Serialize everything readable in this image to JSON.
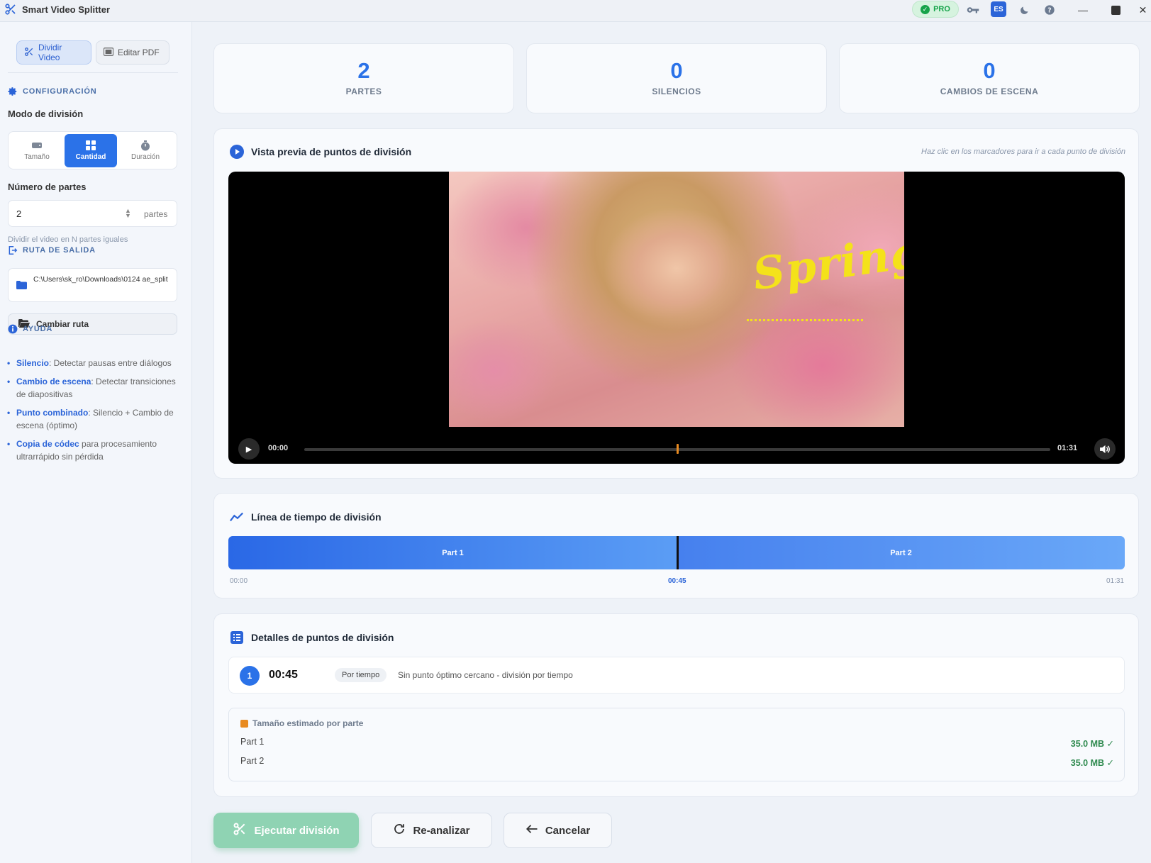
{
  "window": {
    "title": "Smart Video Splitter",
    "pro_label": "PRO",
    "lang_label": "ES"
  },
  "sidebar": {
    "tabs": [
      {
        "label": "Dividir Video"
      },
      {
        "label": "Editar PDF"
      }
    ],
    "config_title": "CONFIGURACIÓN",
    "mode_label": "Modo de división",
    "modes": [
      {
        "label": "Tamaño"
      },
      {
        "label": "Cantidad"
      },
      {
        "label": "Duración"
      }
    ],
    "selected_mode": "Cantidad",
    "parts_label": "Número de partes",
    "parts_value": "2",
    "parts_unit": "partes",
    "parts_hint": "Dividir el video en N partes iguales",
    "output_title": "RUTA DE SALIDA",
    "output_path": "C:\\Users\\sk_ro\\Downloads\\0124 ae_split",
    "change_path_label": "Cambiar ruta",
    "help_title": "AYUDA",
    "help": [
      {
        "term": "Silencio",
        "text": ": Detectar pausas entre diálogos"
      },
      {
        "term": "Cambio de escena",
        "text": ": Detectar transiciones de diapositivas"
      },
      {
        "term": "Punto combinado",
        "text": ": Silencio + Cambio de escena (óptimo)"
      },
      {
        "term": "Copia de códec",
        "text": " para procesamiento ultrarrápido sin pérdida"
      }
    ]
  },
  "stats": [
    {
      "value": "2",
      "label": "PARTES"
    },
    {
      "value": "0",
      "label": "SILENCIOS"
    },
    {
      "value": "0",
      "label": "CAMBIOS DE ESCENA"
    }
  ],
  "preview": {
    "title": "Vista previa de puntos de división",
    "hint": "Haz clic en los marcadores para ir a cada punto de división",
    "overlay_text": "Spring",
    "current_time": "00:00",
    "duration": "01:31",
    "marker_fraction": 0.5
  },
  "timeline": {
    "title": "Línea de tiempo de división",
    "parts": [
      {
        "label": "Part 1"
      },
      {
        "label": "Part 2"
      }
    ],
    "ticks": {
      "start": "00:00",
      "mid": "00:45",
      "end": "01:31"
    }
  },
  "details": {
    "title": "Detalles de puntos de división",
    "points": [
      {
        "index": "1",
        "time": "00:45",
        "tag": "Por tiempo",
        "desc": "Sin punto óptimo cercano - división por tiempo"
      }
    ],
    "size_title": "Tamaño estimado por parte",
    "sizes": [
      {
        "part": "Part 1",
        "size": "35.0 MB ✓"
      },
      {
        "part": "Part 2",
        "size": "35.0 MB ✓"
      }
    ]
  },
  "actions": {
    "execute": "Ejecutar división",
    "reanalyze": "Re-analizar",
    "cancel": "Cancelar"
  },
  "colors": {
    "accent": "#2b72e8",
    "success": "#2f8a4f",
    "execute_bg": "#8fd3b3",
    "marker": "#e88a20"
  }
}
